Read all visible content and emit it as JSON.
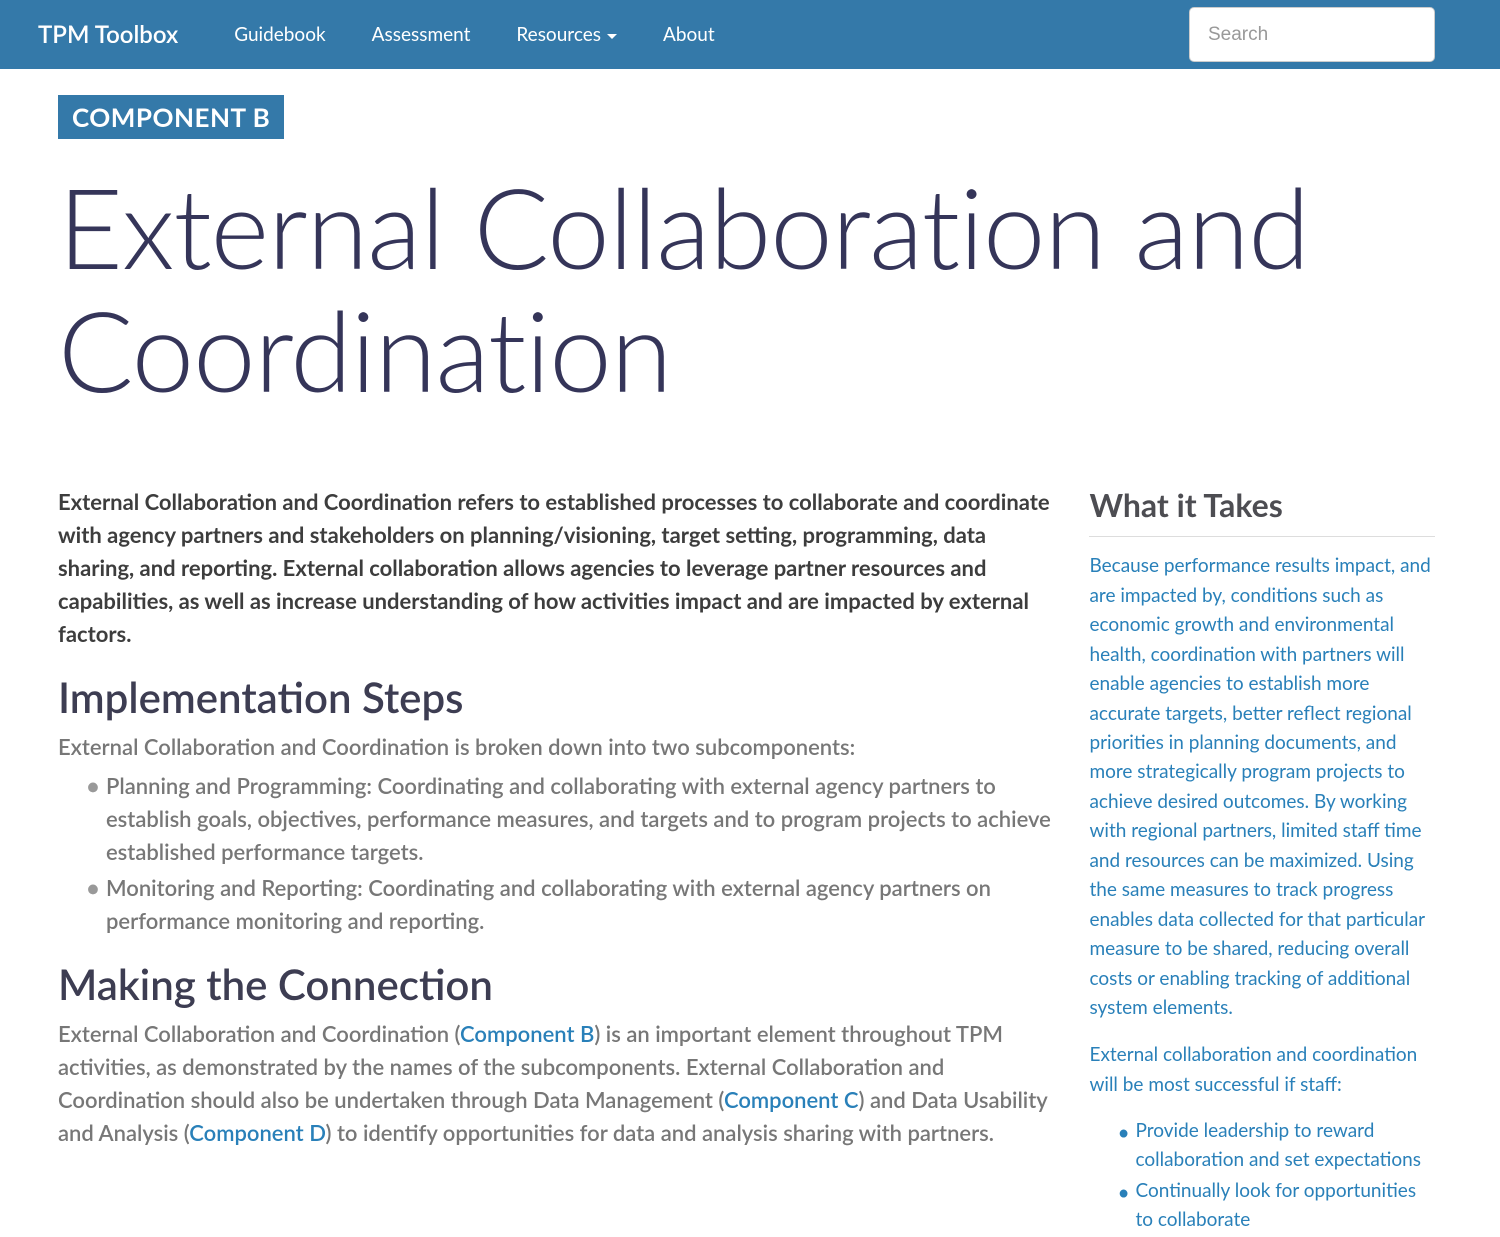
{
  "header": {
    "brand": "TPM Toolbox",
    "nav": [
      {
        "label": "Guidebook",
        "dropdown": false
      },
      {
        "label": "Assessment",
        "dropdown": false
      },
      {
        "label": "Resources",
        "dropdown": true
      },
      {
        "label": "About",
        "dropdown": false
      }
    ],
    "search_placeholder": "Search"
  },
  "page": {
    "component_label": "COMPONENT B",
    "title": "External Collaboration and Coordination",
    "intro": "External Collaboration and Coordination refers to established processes to collaborate and coordinate with agency partners and stakeholders on planning/visioning, target setting, programming, data sharing, and reporting. External collaboration allows agencies to leverage partner resources and capabilities, as well as increase understanding of how activities impact and are impacted by external factors."
  },
  "implementation": {
    "heading": "Implementation Steps",
    "sub": "External Collaboration and Coordination is broken down into two subcomponents:",
    "bullets": [
      "Planning and Programming: Coordinating and collaborating with external agency partners to establish goals, objectives, performance measures, and targets and to program projects to achieve established performance targets.",
      "Monitoring and Reporting: Coordinating and collaborating with external agency partners on performance monitoring and reporting."
    ]
  },
  "connection": {
    "heading": "Making the Connection",
    "parts": {
      "p1": "External Collaboration and Coordination (",
      "link1": "Component B",
      "p2": ") is an important element throughout TPM activities, as demonstrated by the names of the subcomponents. External Collaboration and Coordination should also be undertaken through Data Management (",
      "link2": "Component C",
      "p3": ") and Data Usability and Analysis (",
      "link3": "Component D",
      "p4": ") to identify opportunities for data and analysis sharing with partners."
    }
  },
  "sidebar": {
    "heading": "What it Takes",
    "para1": "Because performance results impact, and are impacted by, conditions such as economic growth and environmental health, coordination with partners will enable agencies to establish more accurate targets, better reflect regional priorities in planning documents, and more strategically program projects to achieve desired outcomes. By working with regional partners, limited staff time and resources can be maximized. Using the same measures to track progress enables data collected for that particular measure to be shared, reducing overall costs or enabling tracking of additional system elements.",
    "para2": "External collaboration and coordination will be most successful if staff:",
    "bullets": [
      "Provide leadership to reward collaboration and set expectations",
      "Continually look for opportunities to collaborate"
    ]
  }
}
